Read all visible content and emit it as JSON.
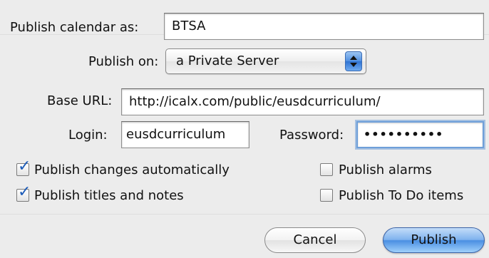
{
  "form": {
    "publish_as_label": "Publish calendar as:",
    "publish_as_value": "BTSA",
    "publish_on_label": "Publish on:",
    "publish_on_value": "a Private Server",
    "base_url_label": "Base URL:",
    "base_url_value": "http://icalx.com/public/eusdcurriculum/",
    "login_label": "Login:",
    "login_value": "eusdcurriculum",
    "password_label": "Password:",
    "password_value": "••••••••••"
  },
  "options": {
    "publish_changes": {
      "label": "Publish changes automatically",
      "checked": true
    },
    "publish_titles": {
      "label": "Publish titles and notes",
      "checked": true
    },
    "publish_alarms": {
      "label": "Publish alarms",
      "checked": false
    },
    "publish_todo": {
      "label": "Publish To Do items",
      "checked": false
    }
  },
  "buttons": {
    "cancel_label": "Cancel",
    "publish_label": "Publish"
  },
  "colors": {
    "default_button": "#4a8fe2",
    "checkmark": "#1d5cb8",
    "focus_ring": "#6e9fd9"
  },
  "icons": {
    "popup_arrows": "up-down-arrows-icon",
    "checkmark": "checkmark-icon"
  }
}
